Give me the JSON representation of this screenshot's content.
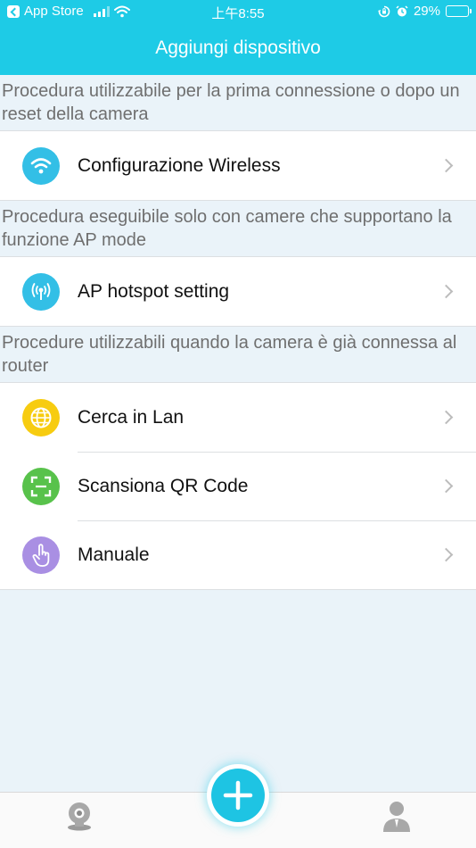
{
  "status_bar": {
    "back_app": "App Store",
    "time": "上午8:55",
    "battery": "29%",
    "battery_level": 0.29
  },
  "header": {
    "title": "Aggiungi dispositivo"
  },
  "sections": [
    {
      "header": "Procedura utilizzabile per la prima connessione o dopo un reset della camera",
      "items": [
        {
          "label": "Configurazione Wireless",
          "icon": "wifi-icon",
          "color": "#33bfe6"
        }
      ]
    },
    {
      "header": "Procedura eseguibile solo con camere che supportano la funzione AP mode",
      "items": [
        {
          "label": "AP hotspot setting",
          "icon": "hotspot-icon",
          "color": "#33bfe6"
        }
      ]
    },
    {
      "header": "Procedure utilizzabili quando la camera è già connessa al router",
      "items": [
        {
          "label": "Cerca in Lan",
          "icon": "globe-icon",
          "color": "#f7cc10"
        },
        {
          "label": "Scansiona QR Code",
          "icon": "qr-scan-icon",
          "color": "#58c24b"
        },
        {
          "label": "Manuale",
          "icon": "hand-pointer-icon",
          "color": "#a98fe3"
        }
      ]
    }
  ],
  "tab_bar": {
    "left_icon": "camera-icon",
    "center_icon": "plus-icon",
    "right_icon": "user-icon"
  }
}
